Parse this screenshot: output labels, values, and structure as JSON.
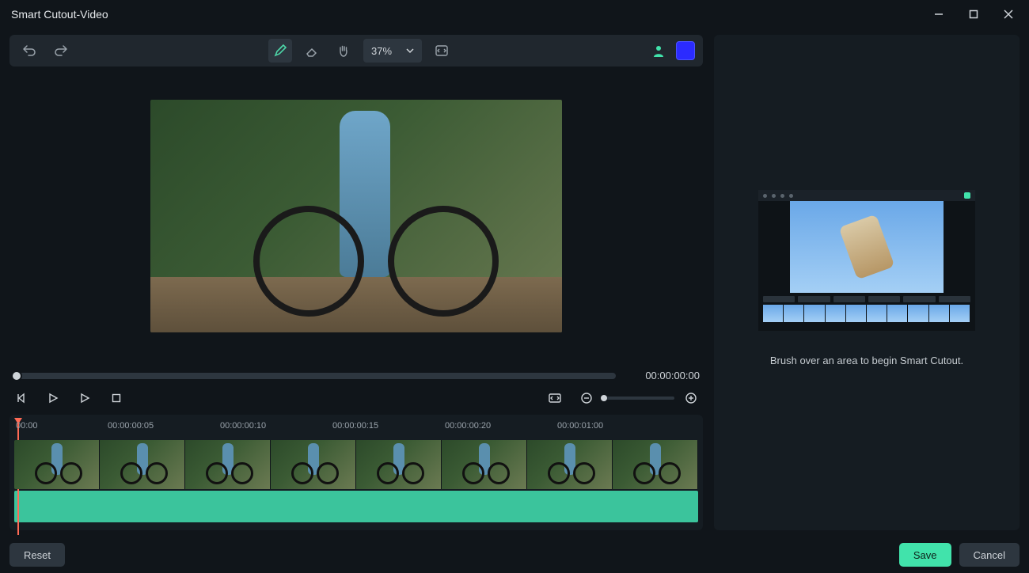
{
  "window": {
    "title": "Smart Cutout-Video"
  },
  "toolbar": {
    "zoom_value": "37%",
    "accent_color": "#2b2bff",
    "person_swatch_color": "#41e3ab"
  },
  "preview": {
    "timecode": "00:00:00:00"
  },
  "timeline": {
    "marks": [
      "00:00",
      "00:00:00:05",
      "00:00:00:10",
      "00:00:00:15",
      "00:00:00:20",
      "00:00:01:00"
    ]
  },
  "right_panel": {
    "hint": "Brush over an area to begin Smart Cutout."
  },
  "buttons": {
    "reset": "Reset",
    "save": "Save",
    "cancel": "Cancel"
  }
}
